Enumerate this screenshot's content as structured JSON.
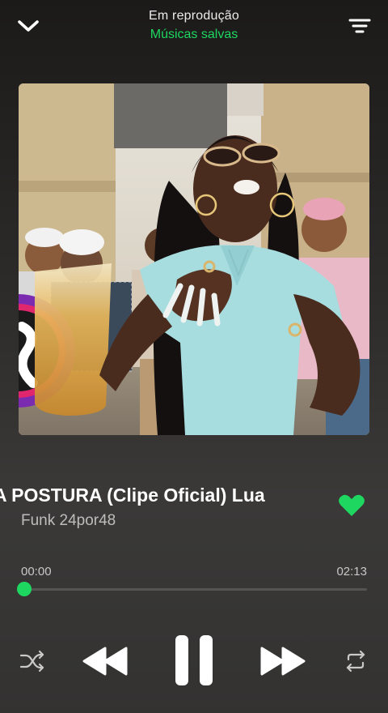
{
  "header": {
    "title": "Em reprodução",
    "subtitle": "Músicas salvas",
    "collapse_icon": "chevron-down-icon",
    "queue_icon": "queue-filter-icon"
  },
  "track": {
    "title": "A POSTURA (Clipe Oficial) Lua",
    "artist": "Funk 24por48",
    "liked": true
  },
  "playback": {
    "elapsed": "00:00",
    "duration": "02:13",
    "progress": 0,
    "state": "playing"
  },
  "controls": {
    "shuffle_icon": "shuffle-icon",
    "previous_icon": "previous-icon",
    "pause_icon": "pause-icon",
    "next_icon": "next-icon",
    "repeat_icon": "repeat-icon"
  },
  "colors": {
    "accent": "#1ed760",
    "background": "#2c2b2a"
  }
}
